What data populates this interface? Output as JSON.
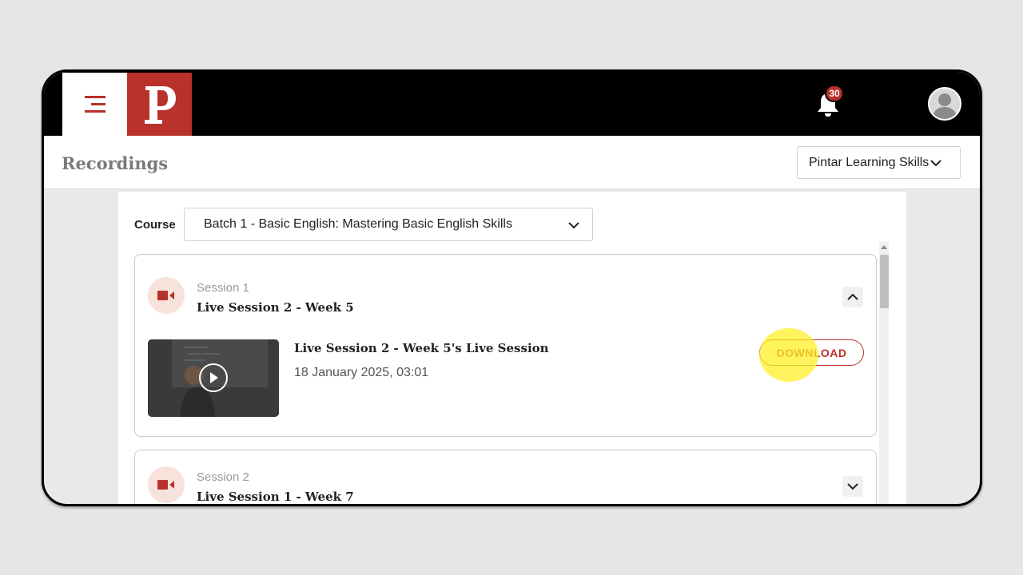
{
  "topbar": {
    "menu_icon": "hamburger-menu-icon",
    "logo_letter": "P",
    "logo_color": "#b8312a",
    "notifications": {
      "icon": "bell-icon",
      "count": "30"
    },
    "avatar_icon": "user-avatar-icon"
  },
  "header": {
    "title": "Recordings",
    "org_select": {
      "value": "Pintar Learning Skills"
    }
  },
  "filters": {
    "course_label": "Course",
    "course_value": "Batch 1 - Basic English: Mastering Basic English Skills"
  },
  "sessions": [
    {
      "number": "Session 1",
      "title": "Live Session 2 - Week 5",
      "expanded": true,
      "recording": {
        "title": "Live Session 2 - Week 5's Live Session",
        "date": "18 January 2025, 03:01",
        "download_label": "DOWNLOAD"
      }
    },
    {
      "number": "Session 2",
      "title": "Live Session 1 - Week 7",
      "expanded": false
    }
  ]
}
